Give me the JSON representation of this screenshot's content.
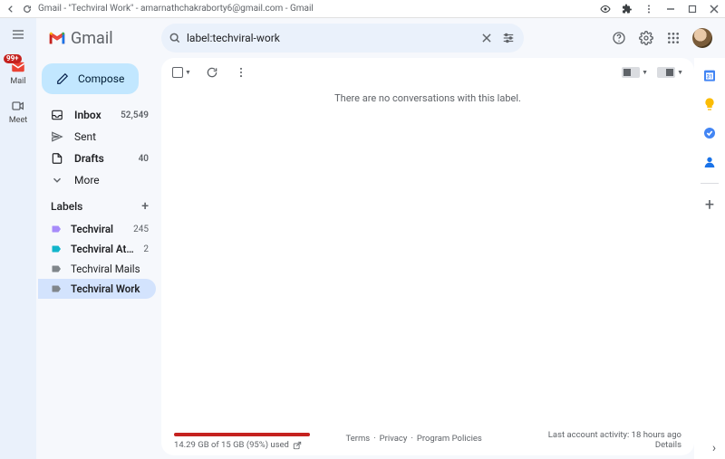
{
  "titlebar": {
    "title": "Gmail - \"Techviral Work\" - amarnathchakraborty6@gmail.com - Gmail"
  },
  "brand": {
    "name": "Gmail"
  },
  "search": {
    "value": "label:techviral-work"
  },
  "rail": {
    "mail": {
      "label": "Mail",
      "badge": "99+"
    },
    "meet": {
      "label": "Meet"
    }
  },
  "compose": {
    "label": "Compose"
  },
  "nav": {
    "inbox": {
      "label": "Inbox",
      "count": "52,549"
    },
    "sent": {
      "label": "Sent"
    },
    "drafts": {
      "label": "Drafts",
      "count": "40"
    },
    "more": {
      "label": "More"
    }
  },
  "labels": {
    "heading": "Labels",
    "items": [
      {
        "name": "Techviral",
        "count": "245",
        "color": "#a78bfa",
        "bold": true
      },
      {
        "name": "Techviral Attachme...",
        "count": "2",
        "color": "#12b5cb",
        "bold": true
      },
      {
        "name": "Techviral Mails",
        "count": "",
        "color": "#80868b",
        "bold": false
      },
      {
        "name": "Techviral Work",
        "count": "",
        "color": "#80868b",
        "bold": true
      }
    ],
    "activeIndex": 3
  },
  "list": {
    "empty_msg": "There are no conversations with this label."
  },
  "footer": {
    "storage": "14.29 GB of 15 GB (95%) used",
    "links": {
      "terms": "Terms",
      "privacy": "Privacy",
      "policies": "Program Policies"
    },
    "activity": "Last account activity: 18 hours ago",
    "details": "Details"
  }
}
